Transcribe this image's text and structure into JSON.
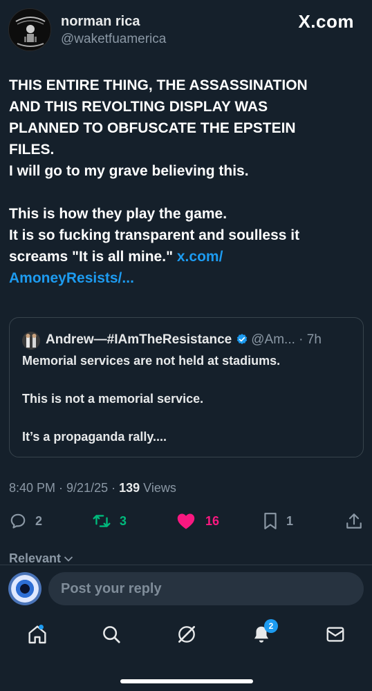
{
  "header": {
    "name": "norman rica",
    "handle": "@waketfuamerica",
    "brand": "X.com"
  },
  "post": {
    "lines": [
      "THIS ENTIRE THING, THE ASSASSINATION",
      "AND THIS REVOLTING DISPLAY WAS",
      "PLANNED TO OBFUSCATE THE EPSTEIN",
      "FILES.",
      "I will go to my grave believing this.",
      "",
      "This is how they play the game.",
      "It is so fucking transparent and soulless it",
      "screams \"It is all mine.\" "
    ],
    "link_part1": "x.com/",
    "link_part2": "AmoneyResists/..."
  },
  "quote": {
    "name": "Andrew—#IAmTheResistance",
    "meta": "@Am... · 7h",
    "lines": [
      "Memorial services are not held at stadiums.",
      "This is not a memorial service.",
      "It’s a propaganda rally...."
    ]
  },
  "meta": {
    "timestamp": "8:40 PM · 9/21/25 · ",
    "views_count": "139",
    "views_label": " Views"
  },
  "actions": {
    "replies": "2",
    "reposts": "3",
    "likes": "16",
    "bookmarks": "1"
  },
  "relevant_label": "Relevant",
  "reply_placeholder": "Post your reply",
  "nav": {
    "notifications_badge": "2"
  },
  "colors": {
    "background": "#15202b",
    "link": "#1d9bf0",
    "repost": "#00ba7c",
    "like": "#f91880"
  }
}
